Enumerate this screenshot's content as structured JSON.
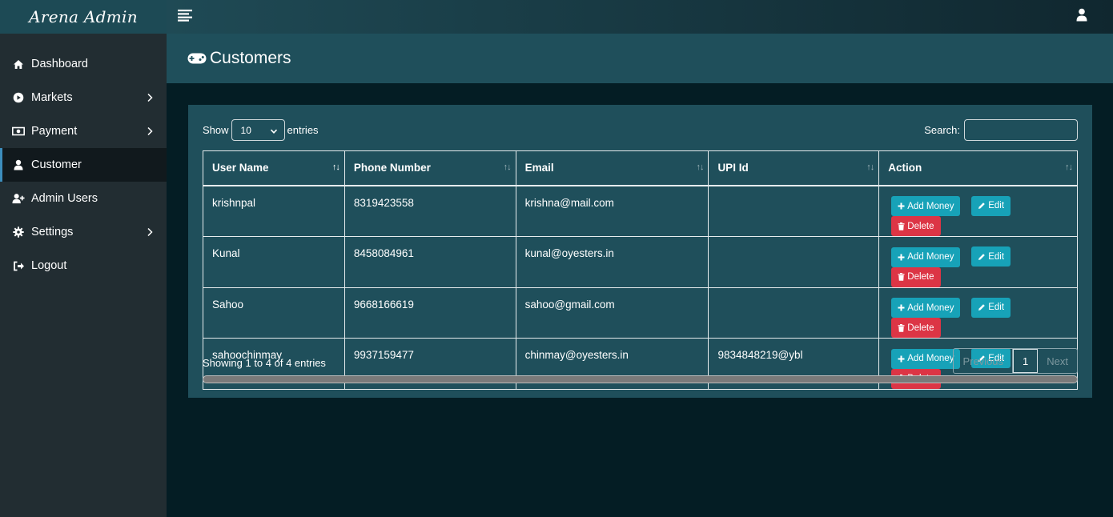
{
  "brand": "Arena Admin",
  "sidebar": {
    "items": [
      {
        "label": "Dashboard",
        "icon": "home-icon",
        "has_chevron": false
      },
      {
        "label": "Markets",
        "icon": "play-circle-icon",
        "has_chevron": true
      },
      {
        "label": "Payment",
        "icon": "money-icon",
        "has_chevron": true
      },
      {
        "label": "Customer",
        "icon": "user-icon",
        "has_chevron": false,
        "active": true
      },
      {
        "label": "Admin Users",
        "icon": "user-plus-icon",
        "has_chevron": false
      },
      {
        "label": "Settings",
        "icon": "gear-icon",
        "has_chevron": true
      },
      {
        "label": "Logout",
        "icon": "sign-out-icon",
        "has_chevron": false
      }
    ]
  },
  "page": {
    "title": "Customers",
    "icon": "gamepad-icon"
  },
  "controls": {
    "show_label": "Show",
    "page_length": "10",
    "entries_label": "entries",
    "search_label": "Search:",
    "search_value": ""
  },
  "table": {
    "columns": [
      "User Name",
      "Phone Number",
      "Email",
      "UPI Id",
      "Action"
    ],
    "rows": [
      {
        "user": "krishnpal",
        "phone": "8319423558",
        "email": "krishna@mail.com",
        "upi": ""
      },
      {
        "user": "Kunal",
        "phone": "8458084961",
        "email": "kunal@oyesters.in",
        "upi": ""
      },
      {
        "user": "Sahoo",
        "phone": "9668166619",
        "email": "sahoo@gmail.com",
        "upi": ""
      },
      {
        "user": "sahoochinmay",
        "phone": "9937159477",
        "email": "chinmay@oyesters.in",
        "upi": "9834848219@ybl"
      }
    ],
    "actions": {
      "add_money": "Add Money",
      "edit": "Edit",
      "delete": "Delete"
    }
  },
  "footer": {
    "info": "Showing 1 to 4 of 4 entries",
    "pager": {
      "previous": "Previous",
      "current": "1",
      "next": "Next"
    }
  },
  "colors": {
    "info": "#17a2b8",
    "danger": "#dc3545",
    "sidebar": "#222d32",
    "panel": "#1f4f5b",
    "background": "#041d24"
  }
}
